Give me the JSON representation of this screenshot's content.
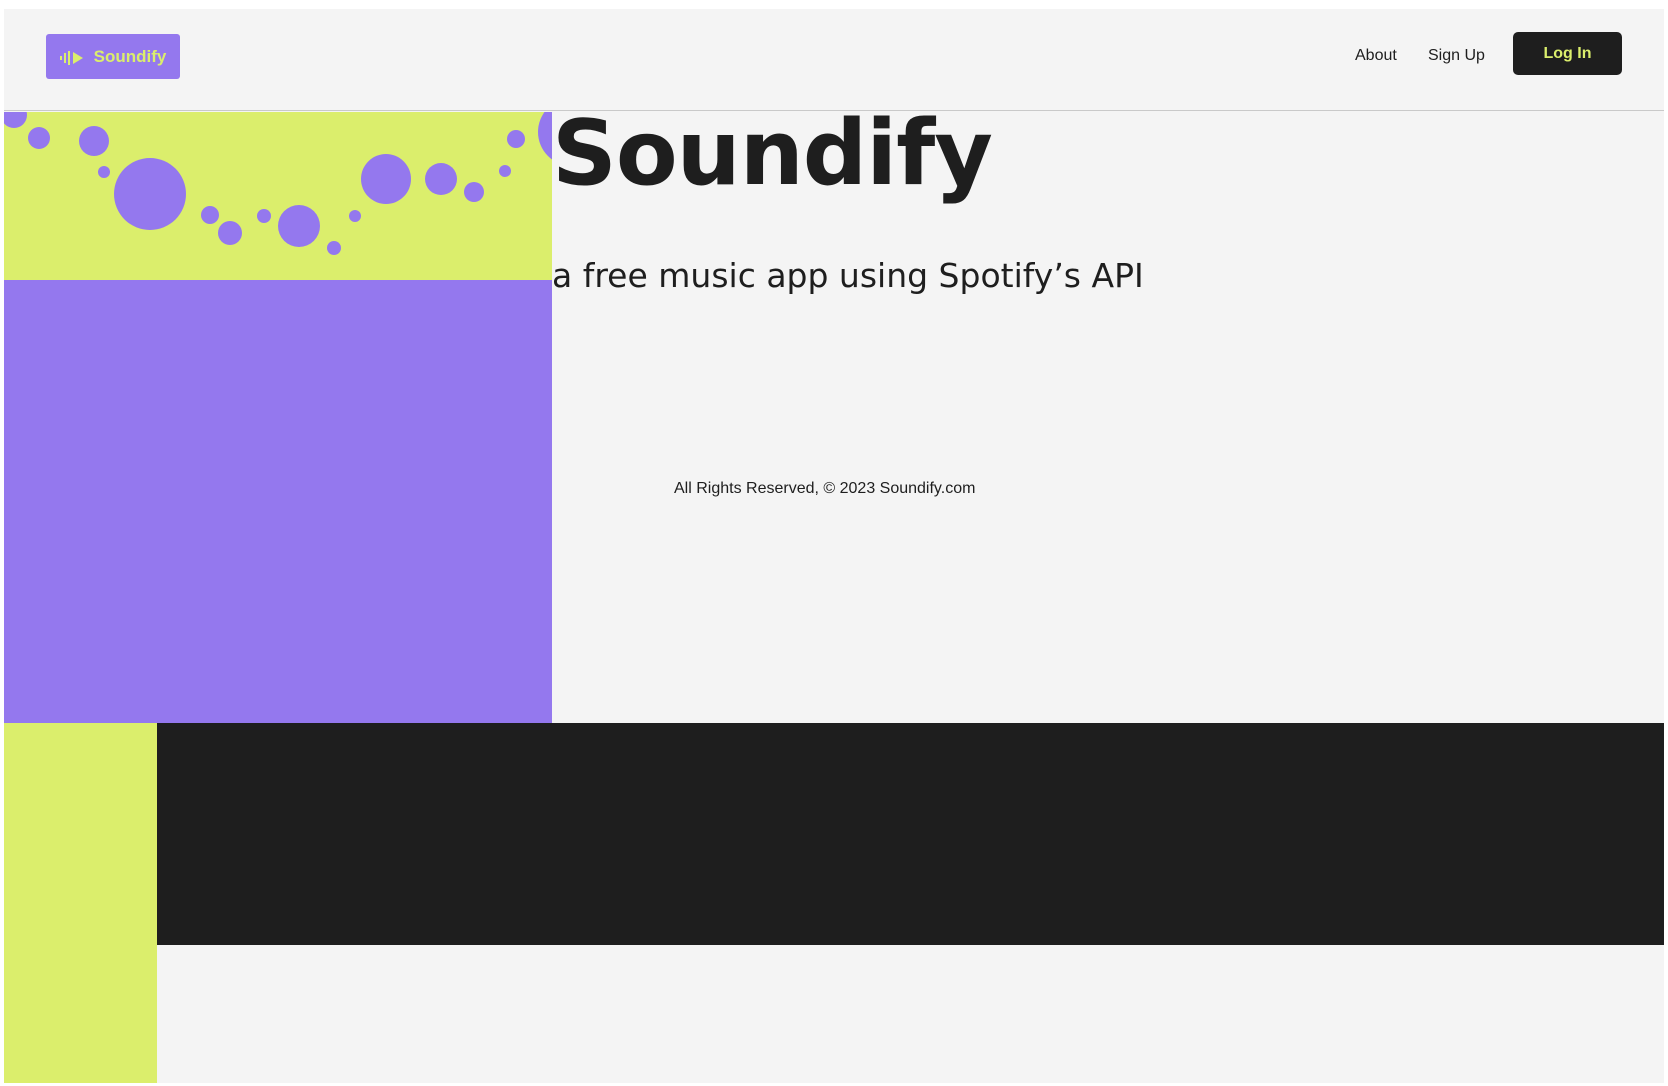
{
  "colors": {
    "page_background": "#f4f4f4",
    "brand_purple": "#9478ee",
    "brand_lime": "#dbee6c",
    "dark": "#1e1e1e"
  },
  "header": {
    "logo_label": "Soundify",
    "logo_icon": "sound-wave-play-icon",
    "nav": {
      "about_label": "About",
      "signup_label": "Sign Up",
      "login_label": "Log In"
    }
  },
  "hero": {
    "title": "Soundify",
    "subtitle": "a free music app using Spotify’s API"
  },
  "footer": {
    "copyright": "All Rights Reserved, © 2023 Soundify.com"
  }
}
